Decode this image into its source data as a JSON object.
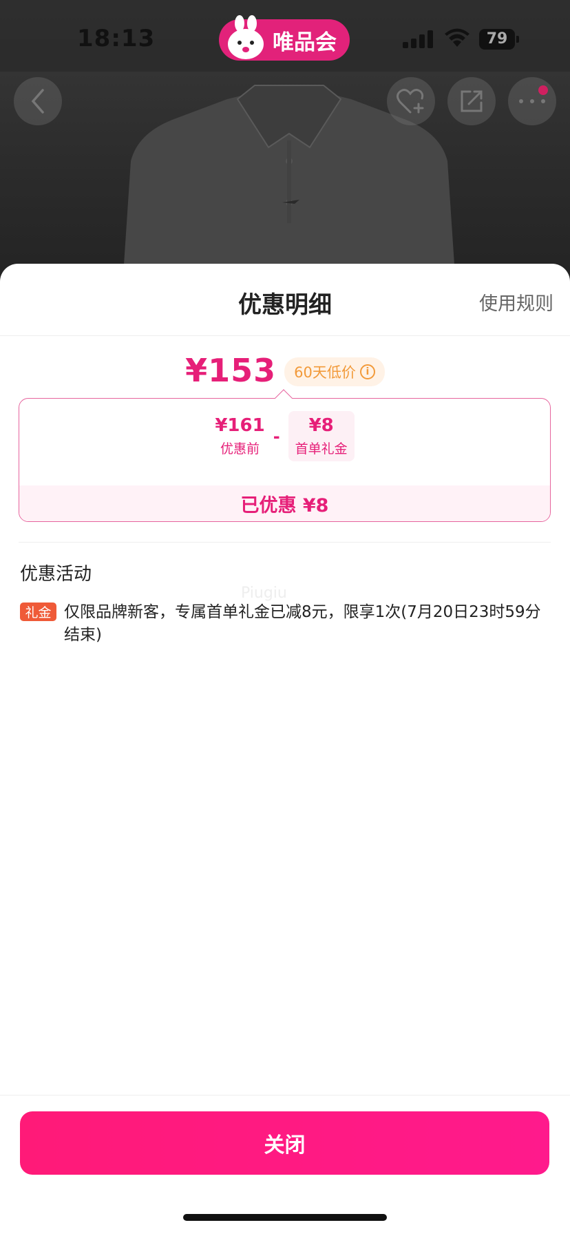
{
  "status_bar": {
    "time": "18:13",
    "brand_name": "唯品会",
    "battery": "79"
  },
  "top_nav": {
    "icons": [
      "back-icon",
      "favorite-add-icon",
      "share-icon",
      "more-icon"
    ]
  },
  "sheet": {
    "title": "优惠明细",
    "rules_link": "使用规则",
    "final_price": "¥153",
    "low_price_tag": "60天低价",
    "breakdown": {
      "original_amount": "¥161",
      "original_label": "优惠前",
      "minus": "-",
      "discount_amount": "¥8",
      "discount_label": "首单礼金",
      "saved_text": "已优惠 ¥8"
    },
    "section_title": "优惠活动",
    "watermark": "Piugiu",
    "promo": {
      "tag": "礼金",
      "text": "仅限品牌新客，专属首单礼金已减8元，限享1次(7月20日23时59分结束)"
    },
    "close_button": "关闭"
  },
  "colors": {
    "accent": "#e61f78",
    "button": "#ff1a78",
    "promo_tag": "#ef5a38",
    "low_tag_text": "#f29a3a"
  }
}
